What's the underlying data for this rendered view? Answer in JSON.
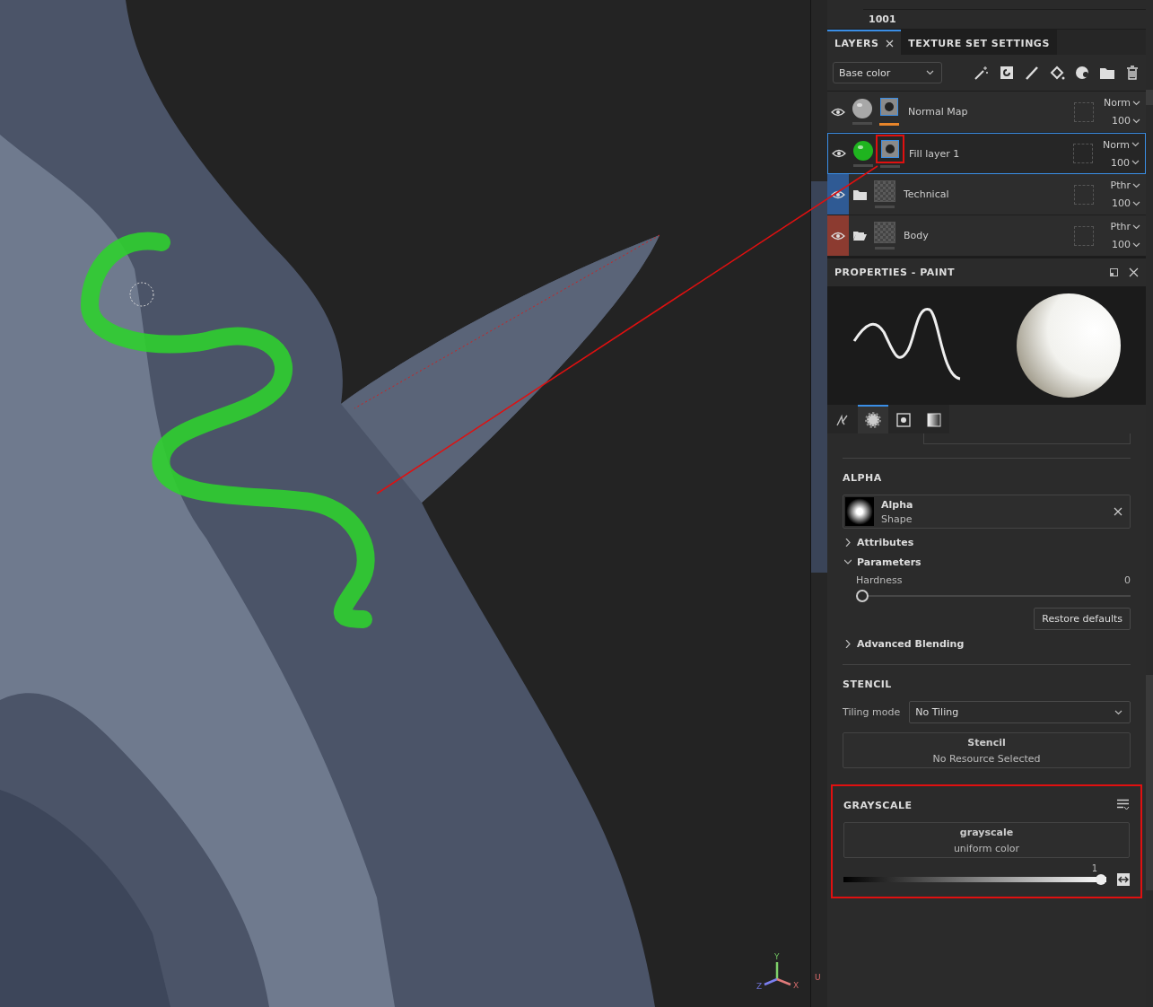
{
  "viewport": {
    "axis_labels": [
      "Y",
      "Z",
      "X"
    ]
  },
  "side_strip": {
    "label": "U"
  },
  "uv_tiles": {
    "tiles": [
      "1001"
    ]
  },
  "layers_panel": {
    "tabs": [
      {
        "label": "LAYERS",
        "selected": true,
        "closable": true
      },
      {
        "label": "TEXTURE SET SETTINGS",
        "selected": false,
        "closable": false
      }
    ],
    "channel": "Base color",
    "layers": [
      {
        "kind": "layer",
        "name": "Normal Map",
        "blend": "Norm",
        "opacity": "100",
        "visible": true,
        "selected": false,
        "color": "#a8a8a8",
        "mask_active": true,
        "mask_highlighted": false
      },
      {
        "kind": "layer",
        "name": "Fill layer 1",
        "blend": "Norm",
        "opacity": "100",
        "visible": true,
        "selected": true,
        "color": "#1fb41f",
        "mask_active": false,
        "mask_highlighted": true
      },
      {
        "kind": "folder",
        "name": "Technical",
        "blend": "Pthr",
        "opacity": "100",
        "visible": true,
        "selected": false,
        "color": "#2f5a94",
        "open": false
      },
      {
        "kind": "folder",
        "name": "Body",
        "blend": "Pthr",
        "opacity": "100",
        "visible": true,
        "selected": false,
        "color": "#8c3b30",
        "open": true
      }
    ]
  },
  "properties": {
    "title": "PROPERTIES - PAINT",
    "tabs": [
      {
        "kind": "brush",
        "selected": false
      },
      {
        "kind": "alpha",
        "selected": true
      },
      {
        "kind": "stencil",
        "selected": false
      },
      {
        "kind": "material",
        "selected": false
      }
    ],
    "alpha": {
      "title": "ALPHA",
      "resource": {
        "name": "Alpha",
        "type": "Shape"
      },
      "groups": [
        {
          "label": "Attributes",
          "expanded": false
        },
        {
          "label": "Parameters",
          "expanded": true,
          "params": [
            {
              "label": "Hardness",
              "value": "0",
              "level": 0
            }
          ],
          "button": "Restore defaults"
        },
        {
          "label": "Advanced Blending",
          "expanded": false
        }
      ]
    },
    "stencil": {
      "title": "STENCIL",
      "tiling_label": "Tiling mode",
      "tiling_value": "No Tiling",
      "resource": {
        "name": "Stencil",
        "type": "No Resource Selected"
      }
    },
    "grayscale": {
      "title": "GRAYSCALE",
      "highlighted": true,
      "resource": {
        "name": "grayscale",
        "type": "uniform color"
      },
      "value": "1",
      "level": 1
    }
  }
}
